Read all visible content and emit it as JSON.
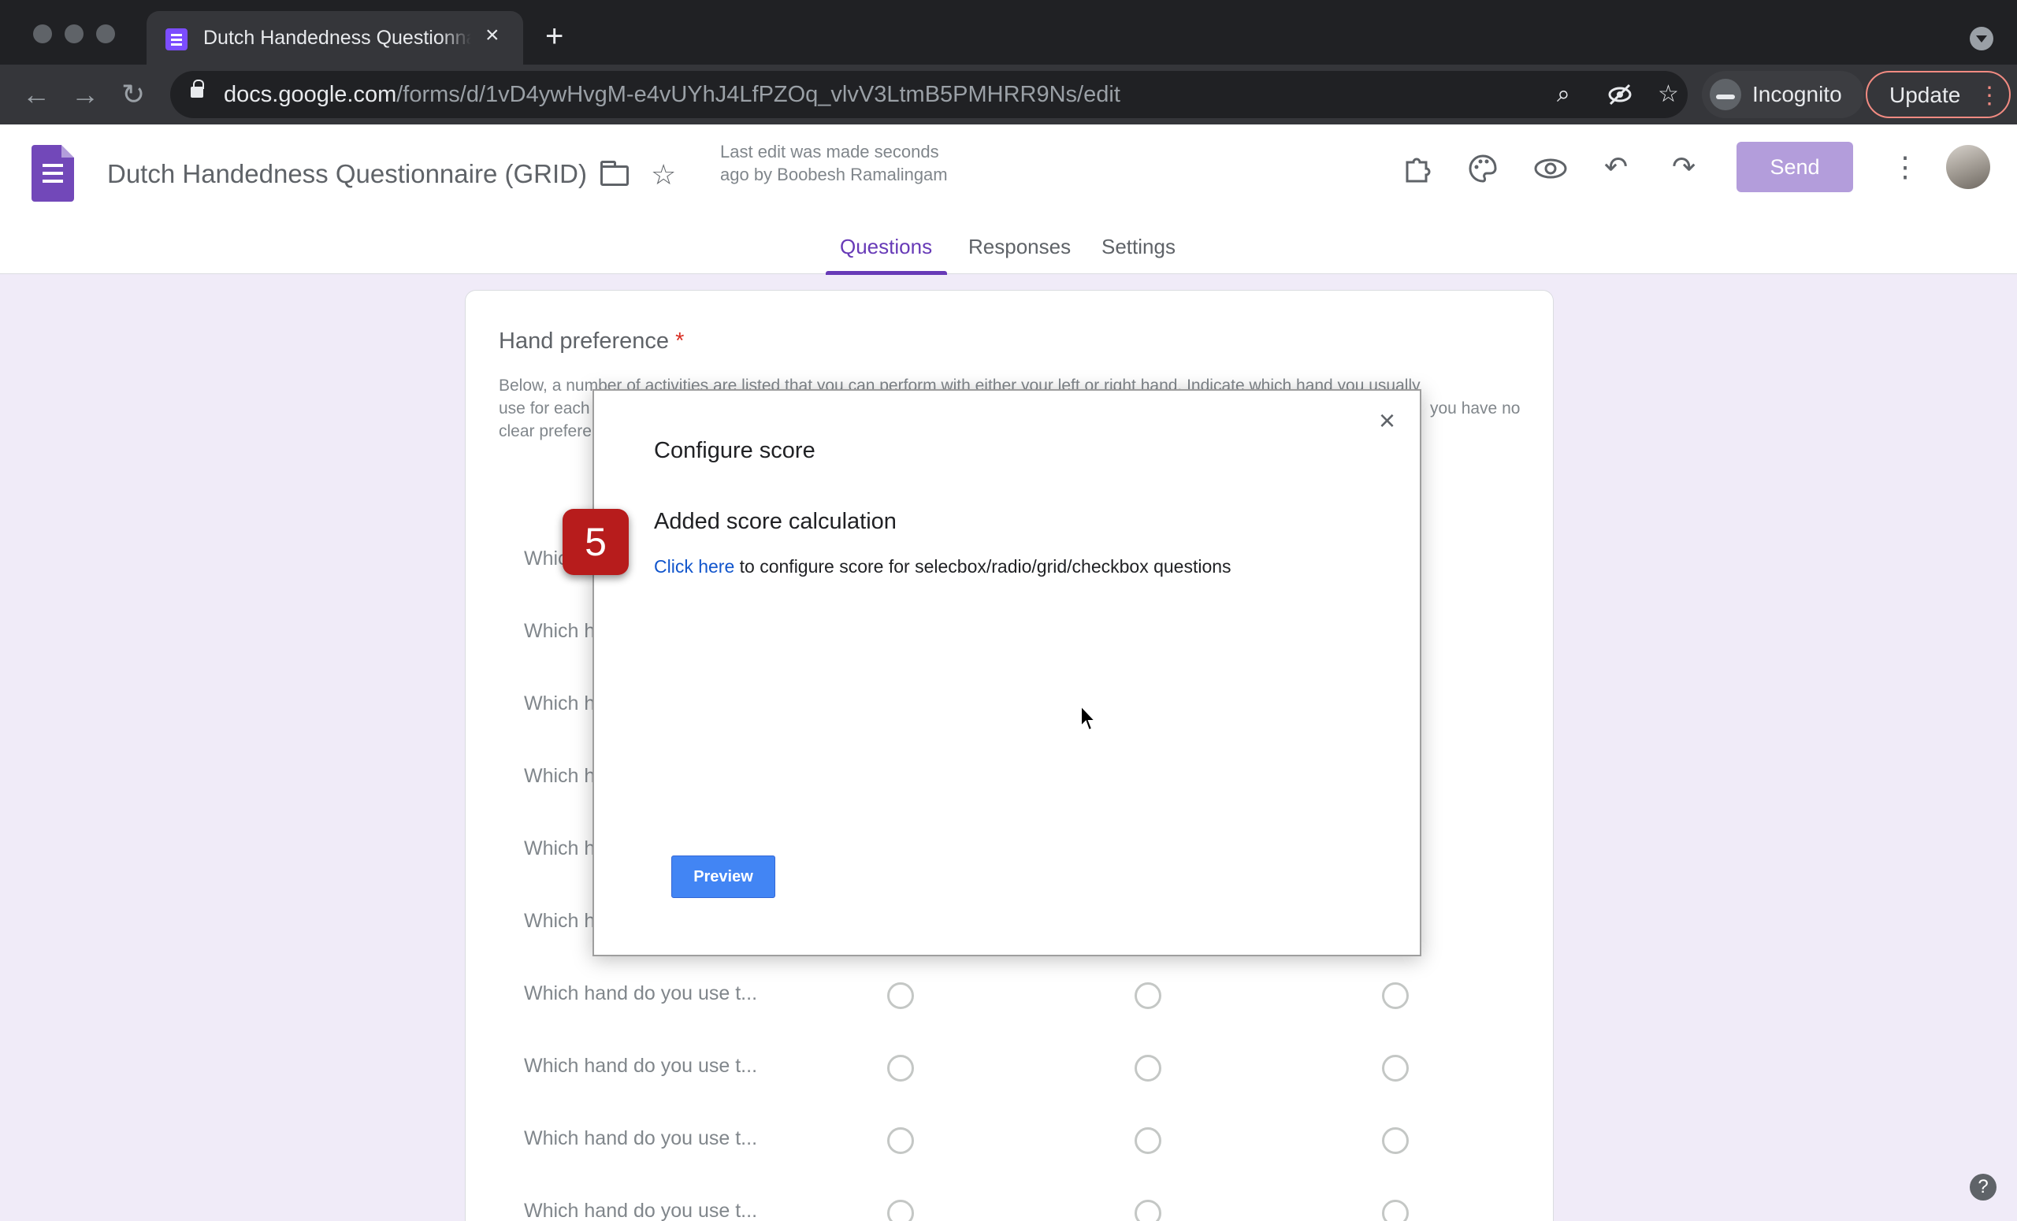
{
  "browser": {
    "tab": {
      "title": "Dutch Handedness Questionnaire (GRID)",
      "close_glyph": "×"
    },
    "new_tab_glyph": "+",
    "url_domain": "docs.google.com",
    "url_path": "/forms/d/1vD4ywHvgM-e4vUYhJ4LfPZOq_vlvV3LtmB5PMHRR9Ns/edit",
    "incognito_label": "Incognito",
    "update_label": "Update",
    "back_glyph": "←",
    "forward_glyph": "→",
    "reload_glyph": "↻",
    "zoom_glyph": "⌕",
    "star_glyph": "☆",
    "kebab_glyph": "⋮"
  },
  "forms_header": {
    "title": "Dutch Handedness Questionnaire (GRID)",
    "last_edit": "Last edit was made seconds ago by Boobesh Ramalingam",
    "send_label": "Send",
    "tabs": [
      "Questions",
      "Responses",
      "Settings"
    ],
    "active_tab": "Questions",
    "icons": {
      "addons": "⚙",
      "palette": "◐",
      "preview": "◉",
      "undo": "↶",
      "redo": "↷",
      "more": "⋮",
      "star": "☆"
    }
  },
  "question": {
    "title": "Hand preference",
    "required_mark": "*",
    "description_visible": [
      "Below, a number of activities are listed that you can perform with either your left or right hand. Indicate which hand you usually",
      "use for each",
      "you have no",
      "clear prefere"
    ],
    "rows": [
      "Whic",
      "Which h",
      "Which h",
      "Which h",
      "Which h",
      "Which h",
      "Which hand do you use t...",
      "Which hand do you use t...",
      "Which hand do you use t...",
      "Which hand do you use t..."
    ]
  },
  "dialog": {
    "title": "Configure score",
    "heading": "Added score calculation",
    "link_text": "Click here",
    "line_rest": " to configure score for selecbox/radio/grid/checkbox questions",
    "preview_label": "Preview",
    "close_glyph": "×"
  },
  "step_badge": "5",
  "help_glyph": "?",
  "colors": {
    "accent": "#673ab7",
    "send_button": "#b39ddb",
    "step_badge": "#b71c1c",
    "link": "#1155cc",
    "preview_button": "#4285f4"
  }
}
